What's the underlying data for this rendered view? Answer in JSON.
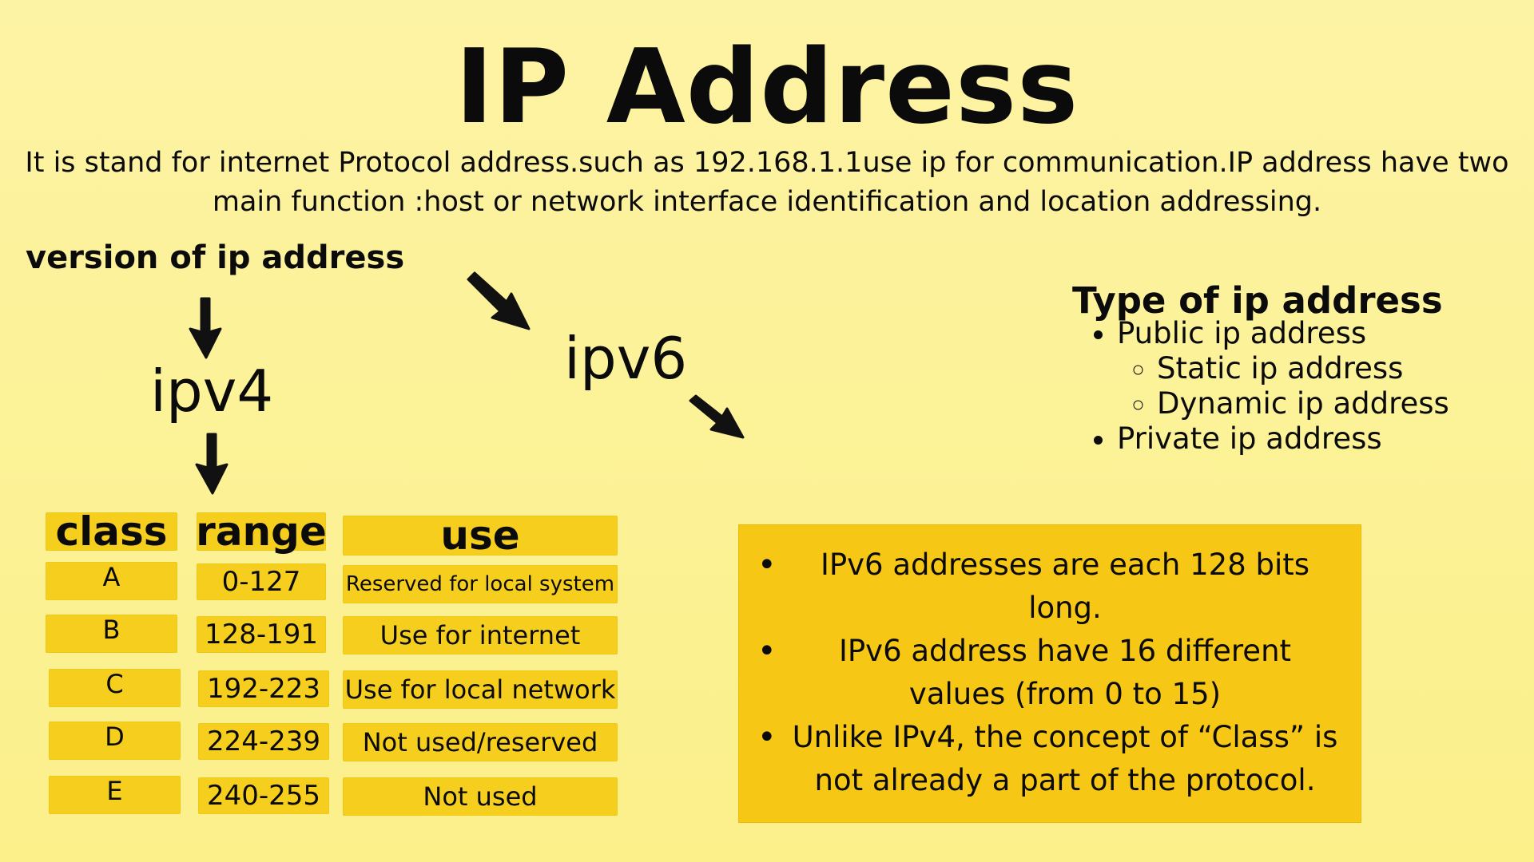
{
  "title": "IP Address",
  "intro": "It is stand for internet Protocol address.such as 192.168.1.1use ip for communication.IP address have two main function :host or network interface identification and location addressing.",
  "versions_heading": "version of ip address",
  "ipv4_label": "ipv4",
  "ipv6_label": "ipv6",
  "types": {
    "heading": "Type of ip address",
    "public": "Public ip address",
    "public_sub": [
      "Static ip address",
      "Dynamic ip address"
    ],
    "private": "Private ip address"
  },
  "table": {
    "headers": {
      "class": "class",
      "range": "range",
      "use": "use"
    },
    "rows": [
      {
        "class": "A",
        "range": "0-127",
        "use": "Reserved for local system"
      },
      {
        "class": "B",
        "range": "128-191",
        "use": "Use for internet"
      },
      {
        "class": "C",
        "range": "192-223",
        "use": "Use for local network"
      },
      {
        "class": "D",
        "range": "224-239",
        "use": "Not used/reserved"
      },
      {
        "class": "E",
        "range": "240-255",
        "use": "Not used"
      }
    ]
  },
  "ipv6_notes": [
    "IPv6 addresses are each 128 bits long.",
    "IPv6 address have 16 different values (from 0 to 15)",
    "Unlike IPv4, the concept of “Class” is not already a part of the protocol."
  ],
  "icons": [
    "arrow-down-icon",
    "arrow-diagonal-icon"
  ],
  "colors": {
    "background": "#fbf08a",
    "cell": "#f6cf1e",
    "ipv6_box": "#f6c715",
    "text": "#0b0b0b"
  }
}
